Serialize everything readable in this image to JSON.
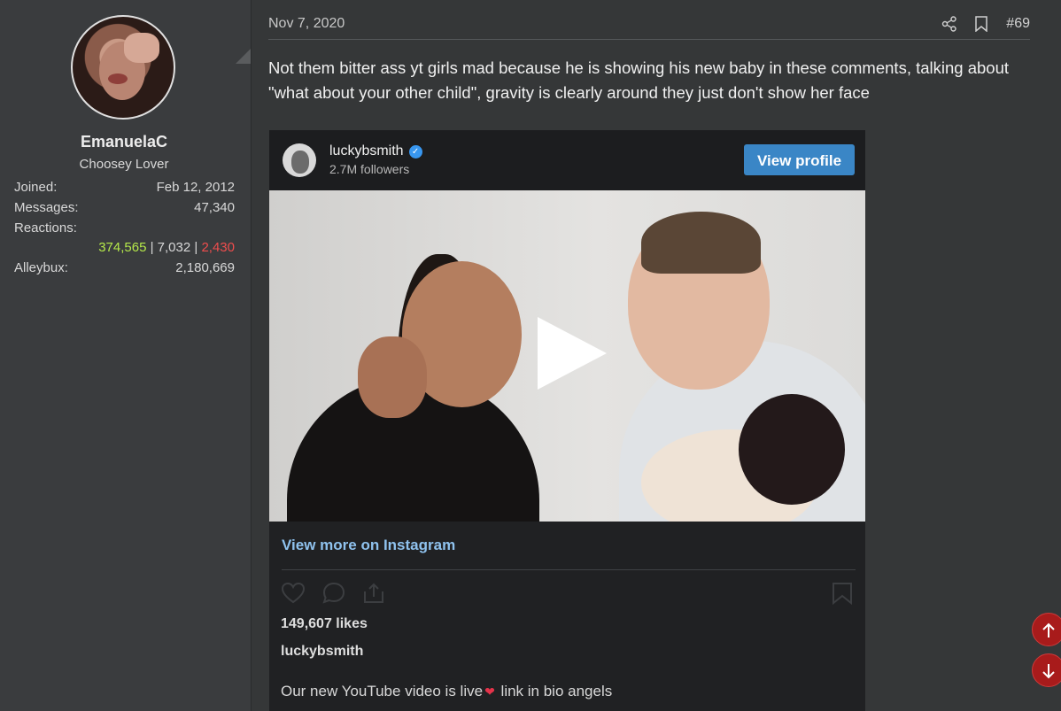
{
  "user": {
    "username": "EmanuelaC",
    "title": "Choosey Lover",
    "stats": [
      {
        "label": "Joined:",
        "value": "Feb 12, 2012"
      },
      {
        "label": "Messages:",
        "value": "47,340"
      },
      {
        "label": "Reactions:",
        "value": ""
      },
      {
        "label": "Alleybux:",
        "value": "2,180,669"
      }
    ],
    "reactions": {
      "positive": "374,565",
      "neutral": "7,032",
      "negative": "2,430",
      "separator": " | "
    }
  },
  "post": {
    "date": "Nov 7, 2020",
    "number": "#69",
    "message": "Not them bitter ass yt girls mad because he is showing his new baby in these comments, talking about \"what about your other child\", gravity is clearly around they just don't show her face"
  },
  "embed": {
    "account": "luckybsmith",
    "followers": "2.7M followers",
    "view_profile": "View profile",
    "view_more": "View more on Instagram",
    "likes": "149,607 likes",
    "caption_user": "luckybsmith",
    "caption_before": "Our new YouTube video is live",
    "caption_after": " link in bio angels"
  },
  "colors": {
    "positive": "#b5e84a",
    "negative": "#ef4d4d",
    "link": "#8fc2ee",
    "button": "#3a86c6",
    "scroll_button": "#a81b1b"
  },
  "icons": [
    "share-icon",
    "bookmark-icon",
    "verified-icon",
    "play-icon",
    "heart-icon",
    "comment-icon",
    "send-icon",
    "save-icon",
    "arrow-up-icon",
    "arrow-down-icon"
  ]
}
